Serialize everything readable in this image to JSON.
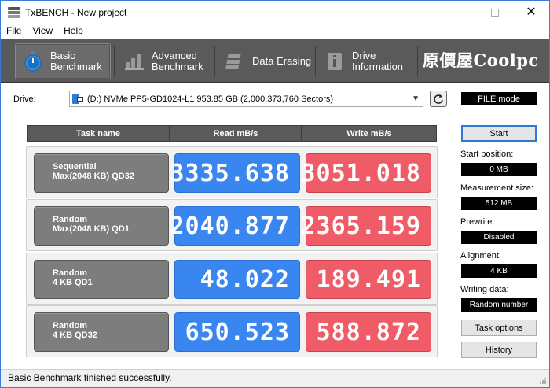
{
  "window": {
    "title": "TxBENCH - New project"
  },
  "menu": [
    "File",
    "View",
    "Help"
  ],
  "tabs": [
    {
      "line1": "Basic",
      "line2": "Benchmark",
      "icon": "stopwatch-icon",
      "active": true
    },
    {
      "line1": "Advanced",
      "line2": "Benchmark",
      "icon": "bar-chart-icon",
      "active": false
    },
    {
      "line1": "Data Erasing",
      "line2": "",
      "icon": "eraser-icon",
      "active": false
    },
    {
      "line1": "Drive",
      "line2": "Information",
      "icon": "drive-info-icon",
      "active": false
    }
  ],
  "brand": "原價屋Coolpc",
  "drive": {
    "label": "Drive:",
    "selected": "(D:) NVMe PP5-GD1024-L1  953.85 GB (2,000,373,760 Sectors)"
  },
  "mode": "FILE mode",
  "table": {
    "headers": {
      "task": "Task name",
      "read": "Read mB/s",
      "write": "Write mB/s"
    },
    "rows": [
      {
        "line1": "Sequential",
        "line2": "Max(2048 KB) QD32",
        "read": "3335.638",
        "write": "3051.018"
      },
      {
        "line1": "Random",
        "line2": "Max(2048 KB) QD1",
        "read": "2040.877",
        "write": "2365.159"
      },
      {
        "line1": "Random",
        "line2": "4 KB QD1",
        "read": "48.022",
        "write": "189.491"
      },
      {
        "line1": "Random",
        "line2": "4 KB QD32",
        "read": "650.523",
        "write": "588.872"
      }
    ]
  },
  "panel": {
    "start": "Start",
    "start_position_label": "Start position:",
    "start_position": "0 MB",
    "measurement_size_label": "Measurement size:",
    "measurement_size": "512 MB",
    "prewrite_label": "Prewrite:",
    "prewrite": "Disabled",
    "alignment_label": "Alignment:",
    "alignment": "4 KB",
    "writing_data_label": "Writing data:",
    "writing_data": "Random number",
    "task_options": "Task options",
    "history": "History"
  },
  "status": "Basic Benchmark finished successfully.",
  "colors": {
    "read": "#3a86f0",
    "write": "#ef5b66",
    "toolbar": "#5a5a5a",
    "accent": "#2c7ad6"
  }
}
